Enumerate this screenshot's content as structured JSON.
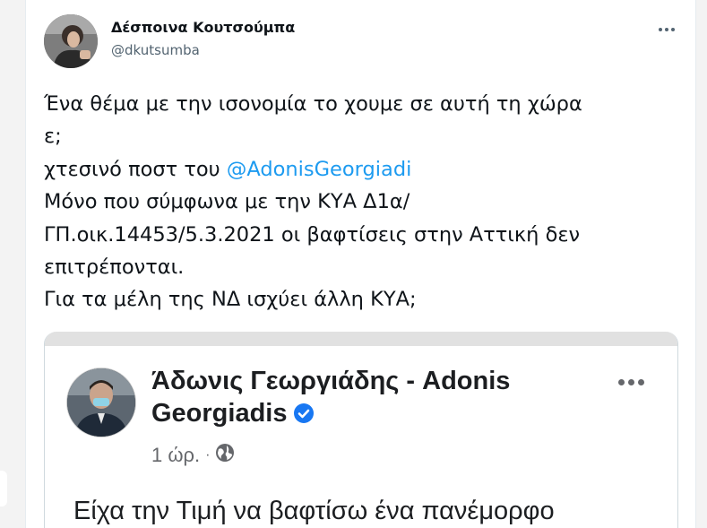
{
  "tweet": {
    "author": {
      "display_name": "Δέσποινα Κουτσούμπα",
      "handle": "@dkutsumba",
      "avatar_icon": "person-avatar"
    },
    "text": {
      "line1": "Ένα θέμα με την ισονομία το χουμε σε αυτή τη χώρα\nε;\nχτεσινό ποστ του ",
      "mention": "@AdonisGeorgiadi",
      "line2": "\nΜόνο που σύμφωνα με την ΚΥΑ Δ1α/\nΓΠ.οικ.14453/5.3.2021 οι βαφτίσεις στην Αττική δεν\nεπιτρέπονται.\nΓια τα μέλη της ΝΔ ισχύει άλλη ΚΥΑ;"
    },
    "more_icon": "more-horizontal-icon"
  },
  "embedded_post": {
    "author_name": "Άδωνις Γεωργιάδης - Adonis Georgiadis",
    "time": "1 ώρ.",
    "separator": "·",
    "audience_icon": "globe-icon",
    "verified_icon": "verified-badge-icon",
    "body_text": "Είχα την Τιμή να βαφτίσω ένα πανέμορφο"
  },
  "colors": {
    "mention": "#1d9bf0",
    "verified": "#1877f2",
    "meta": "#65676b"
  }
}
